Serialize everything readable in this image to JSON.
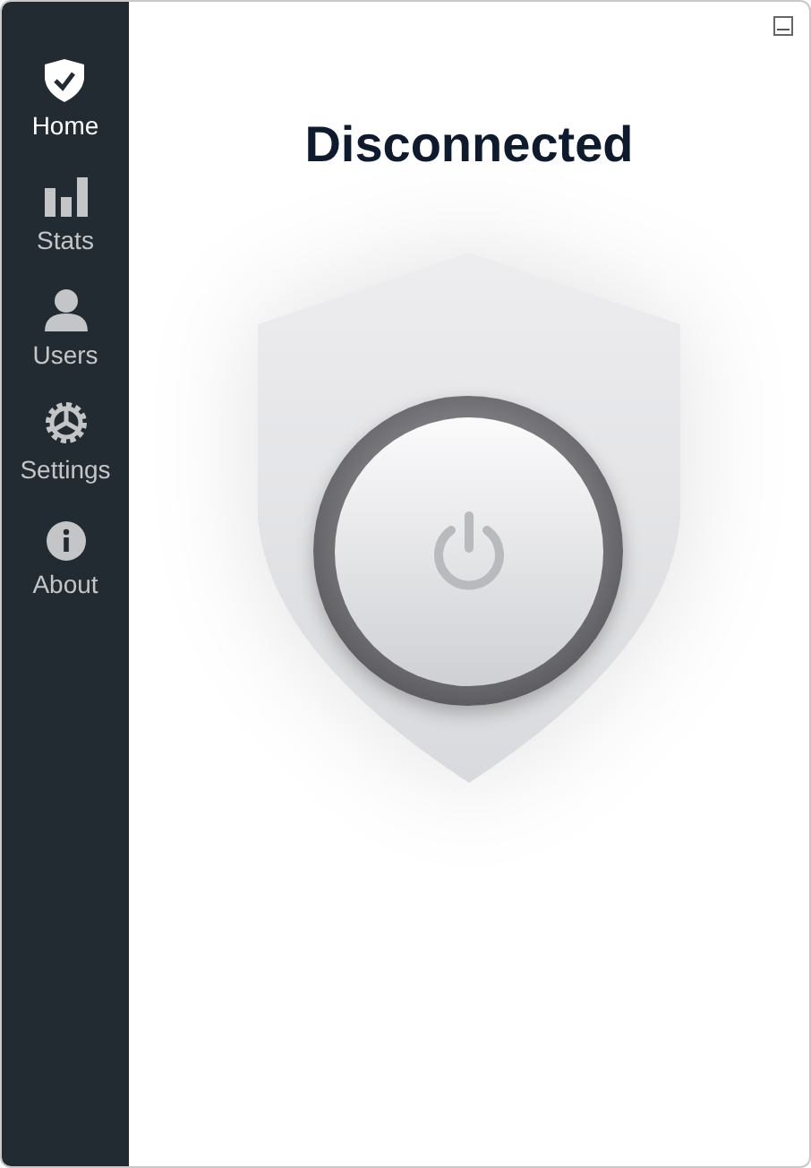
{
  "sidebar": {
    "items": [
      {
        "label": "Home",
        "selected": true
      },
      {
        "label": "Stats",
        "selected": false
      },
      {
        "label": "Users",
        "selected": false
      },
      {
        "label": "Settings",
        "selected": false
      },
      {
        "label": "About",
        "selected": false
      }
    ]
  },
  "main": {
    "status": "Disconnected"
  }
}
